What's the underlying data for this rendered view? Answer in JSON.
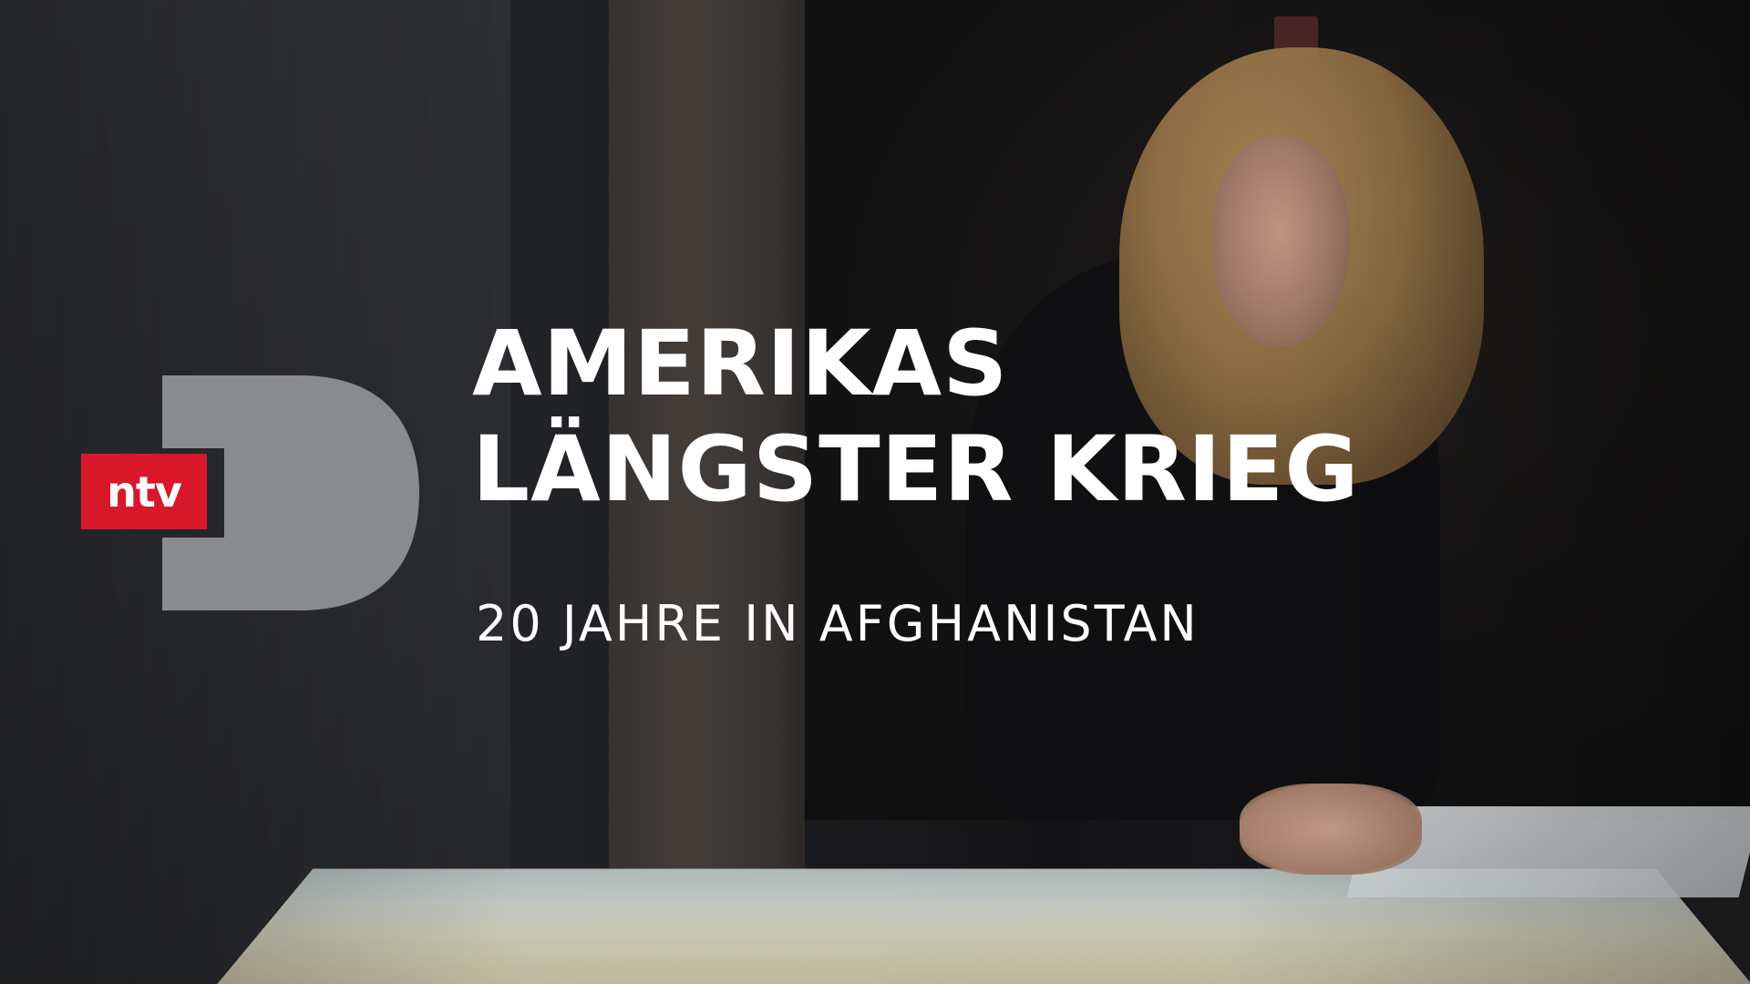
{
  "channel": {
    "logo_text": "ntv",
    "brand_color": "#d8182a",
    "doc_mark_color": "#8a8b8d"
  },
  "show": {
    "title_line1": "AMERIKAS",
    "title_line2": "LÄNGSTER KRIEG",
    "subtitle": "20 JAHRE IN AFGHANISTAN"
  }
}
